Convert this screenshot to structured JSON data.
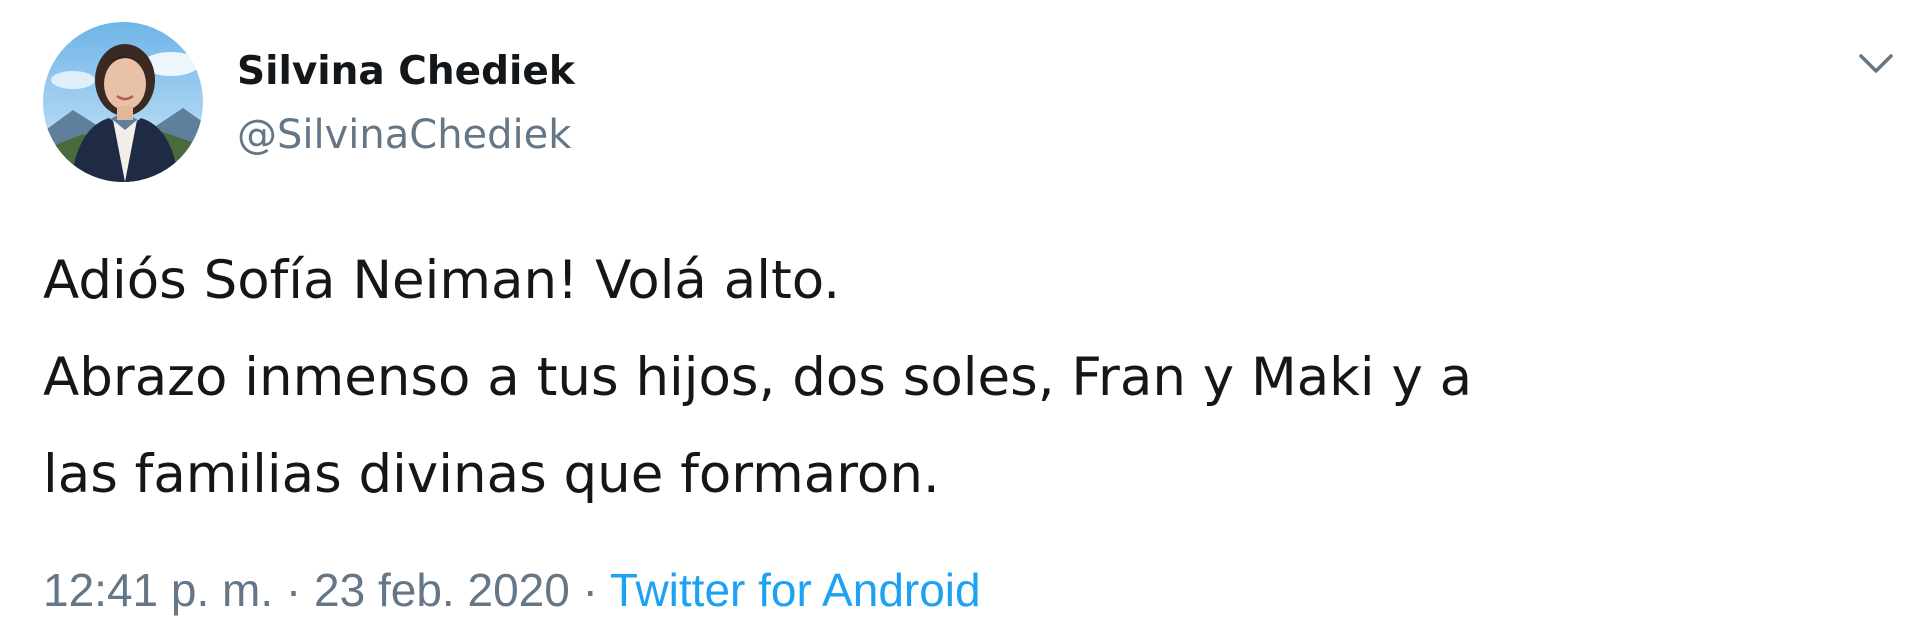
{
  "tweet": {
    "author": {
      "name": "Silvina Chediek",
      "handle": "@SilvinaChediek"
    },
    "text_lines": [
      "Adiós Sofía Neiman! Volá alto.",
      "Abrazo inmenso a tus hijos, dos soles, Fran y Maki y a",
      "las familias divinas que formaron."
    ],
    "time": "12:41 p. m.",
    "separator": "·",
    "date": "23 feb. 2020",
    "source": "Twitter for Android",
    "icons": {
      "avatar": "profile-photo",
      "menu": "chevron-down-icon"
    },
    "colors": {
      "text": "#14171a",
      "secondary": "#657786",
      "link": "#1da1f2"
    }
  }
}
